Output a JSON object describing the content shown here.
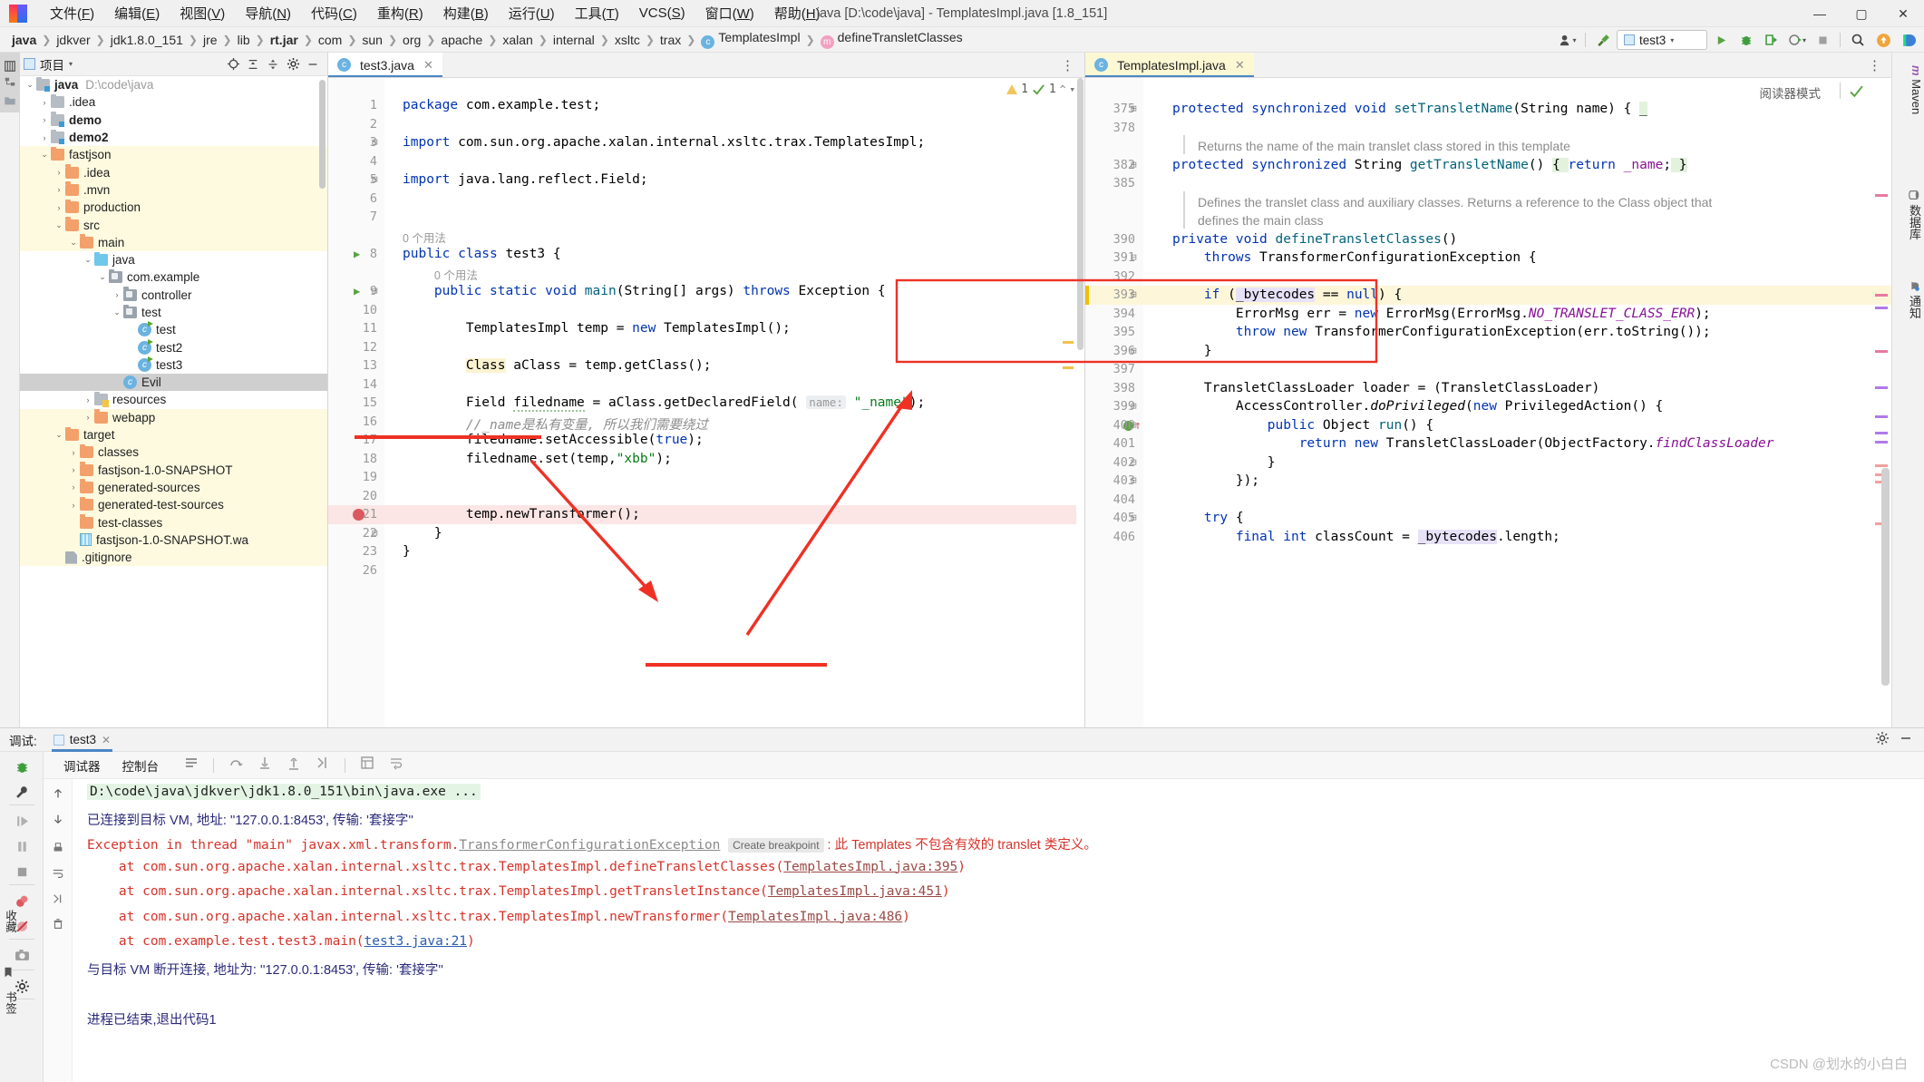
{
  "window": {
    "title": "java [D:\\code\\java] - TemplatesImpl.java [1.8_151]",
    "minimize": "—",
    "maximize": "▢",
    "close": "✕",
    "logo_letter": "IJ"
  },
  "menu": [
    {
      "label": "文件(F)",
      "name": "menu-file"
    },
    {
      "label": "编辑(E)",
      "name": "menu-edit"
    },
    {
      "label": "视图(V)",
      "name": "menu-view"
    },
    {
      "label": "导航(N)",
      "name": "menu-navigate"
    },
    {
      "label": "代码(C)",
      "name": "menu-code"
    },
    {
      "label": "重构(R)",
      "name": "menu-refactor"
    },
    {
      "label": "构建(B)",
      "name": "menu-build"
    },
    {
      "label": "运行(U)",
      "name": "menu-run"
    },
    {
      "label": "工具(T)",
      "name": "menu-tools"
    },
    {
      "label": "VCS(S)",
      "name": "menu-vcs"
    },
    {
      "label": "窗口(W)",
      "name": "menu-window"
    },
    {
      "label": "帮助(H)",
      "name": "menu-help"
    }
  ],
  "breadcrumb": [
    {
      "label": "java",
      "bold": true,
      "icon": ""
    },
    {
      "label": "jdkver",
      "bold": false,
      "icon": ""
    },
    {
      "label": "jdk1.8.0_151",
      "bold": false,
      "icon": ""
    },
    {
      "label": "jre",
      "bold": false,
      "icon": ""
    },
    {
      "label": "lib",
      "bold": false,
      "icon": ""
    },
    {
      "label": "rt.jar",
      "bold": true,
      "icon": ""
    },
    {
      "label": "com",
      "bold": false,
      "icon": ""
    },
    {
      "label": "sun",
      "bold": false,
      "icon": ""
    },
    {
      "label": "org",
      "bold": false,
      "icon": ""
    },
    {
      "label": "apache",
      "bold": false,
      "icon": ""
    },
    {
      "label": "xalan",
      "bold": false,
      "icon": ""
    },
    {
      "label": "internal",
      "bold": false,
      "icon": ""
    },
    {
      "label": "xsltc",
      "bold": false,
      "icon": ""
    },
    {
      "label": "trax",
      "bold": false,
      "icon": ""
    },
    {
      "label": "TemplatesImpl",
      "bold": false,
      "icon": "c"
    },
    {
      "label": "defineTransletClasses",
      "bold": false,
      "icon": "m"
    }
  ],
  "toolbar": {
    "run_config": "test3",
    "icons": [
      "user-icon",
      "hammer-icon",
      "run-icon",
      "debug-icon",
      "run-coverage-icon",
      "profile-icon",
      "stop-icon",
      "search-icon",
      "update-icon",
      "idea-icon"
    ]
  },
  "project_panel": {
    "title": "项目",
    "header_icons": [
      "locate-icon",
      "collapse-icon",
      "expand-icon",
      "settings-icon",
      "hide-icon"
    ],
    "tree": [
      {
        "depth": 0,
        "label": "java",
        "path": "D:\\code\\java",
        "icon": "module-folder",
        "arrow": "v",
        "bold": true,
        "state": "normal"
      },
      {
        "depth": 1,
        "label": ".idea",
        "icon": "gray-folder",
        "arrow": ">",
        "bold": false,
        "state": "normal"
      },
      {
        "depth": 1,
        "label": "demo",
        "icon": "module-folder",
        "arrow": ">",
        "bold": true,
        "state": "normal"
      },
      {
        "depth": 1,
        "label": "demo2",
        "icon": "module-folder",
        "arrow": ">",
        "bold": true,
        "state": "normal"
      },
      {
        "depth": 1,
        "label": "fastjson",
        "icon": "orange-folder",
        "arrow": "v",
        "bold": false,
        "state": "hl"
      },
      {
        "depth": 2,
        "label": ".idea",
        "icon": "orange-folder",
        "arrow": ">",
        "bold": false,
        "state": "hl"
      },
      {
        "depth": 2,
        "label": ".mvn",
        "icon": "orange-folder",
        "arrow": ">",
        "bold": false,
        "state": "hl"
      },
      {
        "depth": 2,
        "label": "production",
        "icon": "orange-folder",
        "arrow": ">",
        "bold": false,
        "state": "hl"
      },
      {
        "depth": 2,
        "label": "src",
        "icon": "orange-folder",
        "arrow": "v",
        "bold": false,
        "state": "hl"
      },
      {
        "depth": 3,
        "label": "main",
        "icon": "orange-folder",
        "arrow": "v",
        "bold": false,
        "state": "hl"
      },
      {
        "depth": 4,
        "label": "java",
        "icon": "blue-folder",
        "arrow": "v",
        "bold": false,
        "state": "normal"
      },
      {
        "depth": 5,
        "label": "com.example",
        "icon": "package",
        "arrow": "v",
        "bold": false,
        "state": "normal"
      },
      {
        "depth": 6,
        "label": "controller",
        "icon": "package",
        "arrow": ">",
        "bold": false,
        "state": "normal"
      },
      {
        "depth": 6,
        "label": "test",
        "icon": "package",
        "arrow": "v",
        "bold": false,
        "state": "normal"
      },
      {
        "depth": 7,
        "label": "test",
        "icon": "class-run",
        "arrow": "",
        "bold": false,
        "state": "normal"
      },
      {
        "depth": 7,
        "label": "test2",
        "icon": "class-run",
        "arrow": "",
        "bold": false,
        "state": "normal"
      },
      {
        "depth": 7,
        "label": "test3",
        "icon": "class-run",
        "arrow": "",
        "bold": false,
        "state": "normal"
      },
      {
        "depth": 6,
        "label": "Evil",
        "icon": "class",
        "arrow": "",
        "bold": false,
        "state": "sel"
      },
      {
        "depth": 4,
        "label": "resources",
        "icon": "resources-folder",
        "arrow": ">",
        "bold": false,
        "state": "normal"
      },
      {
        "depth": 4,
        "label": "webapp",
        "icon": "orange-folder",
        "arrow": ">",
        "bold": false,
        "state": "hl"
      },
      {
        "depth": 2,
        "label": "target",
        "icon": "orange-folder",
        "arrow": "v",
        "bold": false,
        "state": "hl"
      },
      {
        "depth": 3,
        "label": "classes",
        "icon": "orange-folder",
        "arrow": ">",
        "bold": false,
        "state": "hl"
      },
      {
        "depth": 3,
        "label": "fastjson-1.0-SNAPSHOT",
        "icon": "orange-folder",
        "arrow": ">",
        "bold": false,
        "state": "hl"
      },
      {
        "depth": 3,
        "label": "generated-sources",
        "icon": "orange-folder",
        "arrow": ">",
        "bold": false,
        "state": "hl"
      },
      {
        "depth": 3,
        "label": "generated-test-sources",
        "icon": "orange-folder",
        "arrow": ">",
        "bold": false,
        "state": "hl"
      },
      {
        "depth": 3,
        "label": "test-classes",
        "icon": "orange-folder",
        "arrow": "",
        "bold": false,
        "state": "hl"
      },
      {
        "depth": 3,
        "label": "fastjson-1.0-SNAPSHOT.wa",
        "icon": "war-file",
        "arrow": "",
        "bold": false,
        "state": "hl"
      },
      {
        "depth": 2,
        "label": ".gitignore",
        "icon": "file",
        "arrow": "",
        "bold": false,
        "state": "hl"
      }
    ]
  },
  "left_strip": [
    "项目",
    "结构",
    "收藏"
  ],
  "right_strip": [
    "Maven",
    "数据库",
    "通知"
  ],
  "editor_left": {
    "tab": "test3.java",
    "inspections": {
      "warnings": "1",
      "checks": "1"
    },
    "lines": [
      {
        "n": "1",
        "html": "<span class='kw'>package</span> com.example.test;"
      },
      {
        "n": "2",
        "html": ""
      },
      {
        "n": "3",
        "fold": "⊟",
        "html": "<span class='kw'>import</span> com.sun.org.apache.xalan.internal.xsltc.trax.TemplatesImpl;"
      },
      {
        "n": "4",
        "html": ""
      },
      {
        "n": "5",
        "fold": "⊟",
        "html": "<span class='kw'>import</span> java.lang.reflect.Field;"
      },
      {
        "n": "6",
        "html": ""
      },
      {
        "n": "7",
        "html": ""
      },
      {
        "n": "",
        "html": "<span class='hint'>0 个用法</span>"
      },
      {
        "n": "8",
        "run": true,
        "html": "<span class='kw'>public class</span> test3 {"
      },
      {
        "n": "",
        "html": "    <span class='hint'>0 个用法</span>"
      },
      {
        "n": "9",
        "run": true,
        "fold": "⊟",
        "html": "    <span class='kw'>public static void</span> <span style='color:#00627a'>main</span>(String[] args) <span class='kw'>throws</span> Exception {"
      },
      {
        "n": "10",
        "html": ""
      },
      {
        "n": "11",
        "html": "        TemplatesImpl temp = <span class='kw'>new</span> TemplatesImpl();"
      },
      {
        "n": "12",
        "html": ""
      },
      {
        "n": "13",
        "html": "        <span class='hl-class'>Class</span> aClass = temp.getClass();"
      },
      {
        "n": "14",
        "html": ""
      },
      {
        "n": "15",
        "html": "        Field <span class='underline-sq'>filedname</span> = aClass.getDeclaredField( <span class='paramhint'>name:</span> <span class='str'>\"_name\"</span>);"
      },
      {
        "n": "16",
        "html": "        <span class='cmt'>//_name是私有变量, 所以我们需要绕过</span>"
      },
      {
        "n": "17",
        "html": "        filedname.setAccessible(<span class='kw'>true</span>);"
      },
      {
        "n": "18",
        "html": "        filedname.set(temp,<span class='str'>\"xbb\"</span>);"
      },
      {
        "n": "19",
        "html": ""
      },
      {
        "n": "20",
        "html": ""
      },
      {
        "n": "21",
        "bp": true,
        "html": "        temp.newTransformer();"
      },
      {
        "n": "22",
        "fold": "⊟",
        "html": "    }"
      },
      {
        "n": "23",
        "html": "}"
      },
      {
        "n": "26",
        "html": ""
      }
    ]
  },
  "editor_right": {
    "tab": "TemplatesImpl.java",
    "reader_mode": "阅读器模式",
    "lines": [
      {
        "n": "375",
        "fold": "⊞",
        "html": "<span class='kw'>protected synchronized void</span> <span style='color:#00627a'>setTransletName</span>(String name) { <span class='greenhl'>_</span>"
      },
      {
        "n": "378",
        "html": ""
      },
      {
        "n": "",
        "doc": true,
        "html": "Returns the name of the main translet class stored in this template"
      },
      {
        "n": "382",
        "fold": "⊞",
        "html": "<span class='kw'>protected synchronized</span> String <span style='color:#00627a'>getTransletName</span>() <span class='greenhl'>{ </span><span class='kw'>return</span> <span style='color:#871094'>_name</span>;<span class='greenhl'> }</span>"
      },
      {
        "n": "385",
        "html": ""
      },
      {
        "n": "",
        "doc": true,
        "html": "Defines the translet class and auxiliary classes. Returns a reference to the Class object that"
      },
      {
        "n": "",
        "doc": true,
        "html": "defines the main class"
      },
      {
        "n": "390",
        "html": "<span class='kw'>private void</span> <span style='color:#00627a'>defineTransletClasses</span>()"
      },
      {
        "n": "391",
        "fold": "⊟",
        "html": "    <span class='kw'>throws</span> TransformerConfigurationException {"
      },
      {
        "n": "392",
        "html": ""
      },
      {
        "n": "393",
        "fold": "⊟",
        "cur": true,
        "html": "    <span class='kw'>if</span> (<span class='purplehl'>_bytecodes</span> == <span class='kw'>null</span>) {"
      },
      {
        "n": "394",
        "html": "        ErrorMsg err = <span class='kw'>new</span> ErrorMsg(ErrorMsg.<span class='ital' style='color:#871094'>NO_TRANSLET_CLASS_ERR</span>);"
      },
      {
        "n": "395",
        "html": "        <span class='kw'>throw new</span> TransformerConfigurationException(err.toString());"
      },
      {
        "n": "396",
        "fold": "⊟",
        "html": "    }"
      },
      {
        "n": "397",
        "html": ""
      },
      {
        "n": "398",
        "html": "    TransletClassLoader loader = (TransletClassLoader)"
      },
      {
        "n": "399",
        "fold": "⊟",
        "html": "        AccessController.<span class='ital'>doPrivileged</span>(<span class='kw'>new</span> PrivilegedAction() {"
      },
      {
        "n": "400",
        "bpgreen": true,
        "fold": "⊟",
        "html": "            <span class='kw'>public</span> Object <span style='color:#00627a'>run</span>() {"
      },
      {
        "n": "401",
        "html": "                <span class='kw'>return new</span> TransletClassLoader(ObjectFactory.<span class='ital' style='color:#871094'>findClassLoader</span>"
      },
      {
        "n": "402",
        "fold": "⊟",
        "html": "            }"
      },
      {
        "n": "403",
        "fold": "⊟",
        "html": "        });"
      },
      {
        "n": "404",
        "html": ""
      },
      {
        "n": "405",
        "fold": "⊟",
        "html": "    <span class='kw'>try</span> {"
      },
      {
        "n": "406",
        "html": "        <span class='kw'>final int</span> classCount = <span class='purplehl'>_bytecodes</span>.length;"
      }
    ]
  },
  "debug": {
    "label": "调试:",
    "tab": "test3",
    "sub_tabs": [
      {
        "label": "调试器",
        "active": false
      },
      {
        "label": "控制台",
        "active": true
      }
    ],
    "console_lines": [
      {
        "type": "cmd",
        "text": "D:\\code\\java\\jdkver\\jdk1.8.0_151\\bin\\java.exe ..."
      },
      {
        "type": "plain",
        "text": "已连接到目标 VM, 地址: ''127.0.0.1:8453', 传输: '套接字''"
      },
      {
        "type": "exception",
        "prefix": "Exception in thread \"main\" javax.xml.transform.",
        "link": "TransformerConfigurationException",
        "badge": "Create breakpoint",
        "suffix": " : 此 Templates 不包含有效的 translet 类定义。"
      },
      {
        "type": "stack",
        "text": "    at com.sun.org.apache.xalan.internal.xsltc.trax.TemplatesImpl.defineTransletClasses(",
        "link": "TemplatesImpl.java:395",
        "close": ")",
        "underlined": true
      },
      {
        "type": "stack",
        "text": "    at com.sun.org.apache.xalan.internal.xsltc.trax.TemplatesImpl.getTransletInstance(",
        "link": "TemplatesImpl.java:451",
        "close": ")"
      },
      {
        "type": "stack",
        "text": "    at com.sun.org.apache.xalan.internal.xsltc.trax.TemplatesImpl.newTransformer(",
        "link": "TemplatesImpl.java:486",
        "close": ")"
      },
      {
        "type": "stack-blue",
        "text": "    at com.example.test.test3.main(",
        "link": "test3.java:21",
        "close": ")"
      },
      {
        "type": "plain",
        "text": "与目标 VM 断开连接, 地址为: ''127.0.0.1:8453', 传输: '套接字''"
      },
      {
        "type": "plain",
        "text": ""
      },
      {
        "type": "plain",
        "text": "进程已结束,退出代码1"
      }
    ],
    "bottom_labels": [
      "收藏",
      "书签"
    ]
  },
  "watermark": "CSDN @划水的小白白",
  "colors": {
    "accent": "#4a86c5",
    "annotation_red": "#e8453c",
    "keyword_blue": "#0033b3",
    "string_green": "#067d17",
    "highlight_yellow": "#fdfae0"
  }
}
